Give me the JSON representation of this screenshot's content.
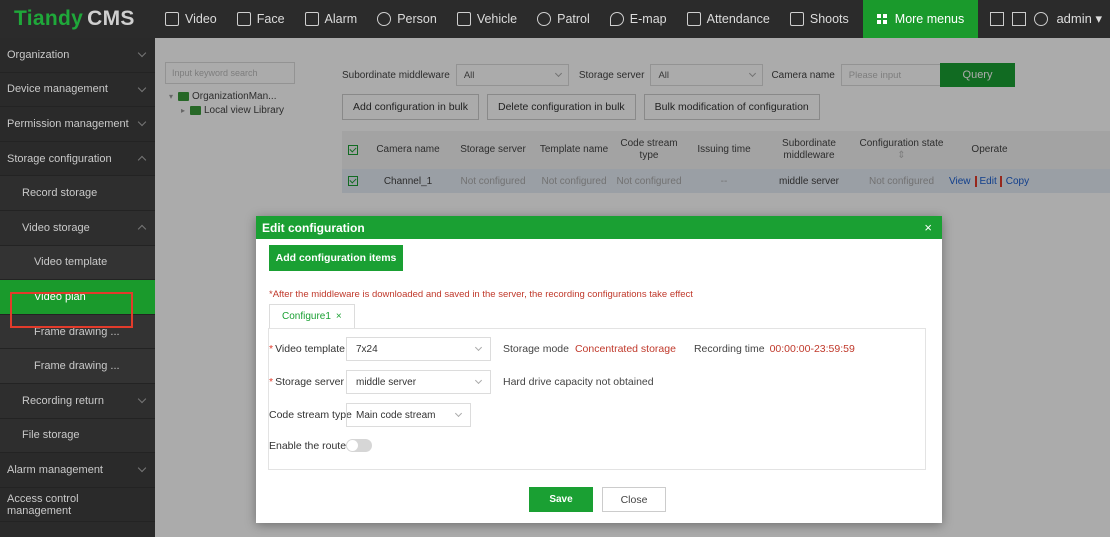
{
  "app": {
    "logo_brand": "Tiandy",
    "logo_product": "CMS",
    "user": "admin ▾"
  },
  "nav": [
    {
      "label": "Video",
      "icon": "video-icon"
    },
    {
      "label": "Face",
      "icon": "face-icon"
    },
    {
      "label": "Alarm",
      "icon": "alarm-icon"
    },
    {
      "label": "Person",
      "icon": "person-icon"
    },
    {
      "label": "Vehicle",
      "icon": "vehicle-icon"
    },
    {
      "label": "Patrol",
      "icon": "patrol-icon"
    },
    {
      "label": "E-map",
      "icon": "map-pin-icon"
    },
    {
      "label": "Attendance",
      "icon": "calendar-icon"
    },
    {
      "label": "Shoots",
      "icon": "camera-icon"
    },
    {
      "label": "More menus",
      "icon": "grid-icon"
    }
  ],
  "sidebar": [
    {
      "label": "Organization"
    },
    {
      "label": "Device management"
    },
    {
      "label": "Permission management"
    },
    {
      "label": "Storage configuration"
    },
    {
      "label": "Record storage"
    },
    {
      "label": "Video storage"
    },
    {
      "label": "Video template"
    },
    {
      "label": "Video plan"
    },
    {
      "label": "Frame drawing ..."
    },
    {
      "label": "Frame drawing ..."
    },
    {
      "label": "Recording return"
    },
    {
      "label": "File storage"
    },
    {
      "label": "Alarm management"
    },
    {
      "label": "Access control management"
    }
  ],
  "org": {
    "search_placeholder": "Input keyword search",
    "tree_root": "OrganizationMan...",
    "tree_child": "Local view Library"
  },
  "filter": {
    "middleware_label": "Subordinate middleware",
    "middleware_value": "All",
    "storage_label": "Storage server",
    "storage_value": "All",
    "camera_label": "Camera name",
    "camera_placeholder": "Please input",
    "query": "Query"
  },
  "bulk": {
    "add": "Add configuration in bulk",
    "delete": "Delete configuration in bulk",
    "modify": "Bulk modification of configuration"
  },
  "table": {
    "headers": [
      "Camera name",
      "Storage server",
      "Template name",
      "Code stream type",
      "Issuing time",
      "Subordinate middleware",
      "Configuration state",
      "Operate"
    ],
    "state_sort_icon": "⇕",
    "row": {
      "camera": "Channel_1",
      "storage": "Not configured",
      "template": "Not configured",
      "stream": "Not configured",
      "time": "--",
      "middleware": "middle server",
      "state": "Not configured",
      "view": "View",
      "edit": "Edit",
      "copy": "Copy"
    }
  },
  "modal": {
    "title": "Edit configuration",
    "close": "×",
    "add_items": "Add configuration items",
    "notice": "*After the middleware is downloaded and saved in the server, the recording configurations take effect",
    "tab": "Configure1",
    "tab_close": "×",
    "video_template_label": "Video template",
    "video_template_value": "7x24",
    "storage_mode_label": "Storage mode",
    "storage_mode_value": "Concentrated storage",
    "recording_time_label": "Recording time",
    "recording_time_value": "00:00:00-23:59:59",
    "storage_server_label": "Storage server",
    "storage_server_value": "middle server",
    "capacity_note": "Hard drive capacity not obtained",
    "code_stream_label": "Code stream type",
    "code_stream_value": "Main code stream",
    "route_label": "Enable the route",
    "route_enabled": false,
    "save": "Save",
    "close_btn": "Close"
  },
  "colors": {
    "accent": "#1aa033",
    "highlight": "#e23b2b",
    "warning_text": "#c0392b"
  }
}
